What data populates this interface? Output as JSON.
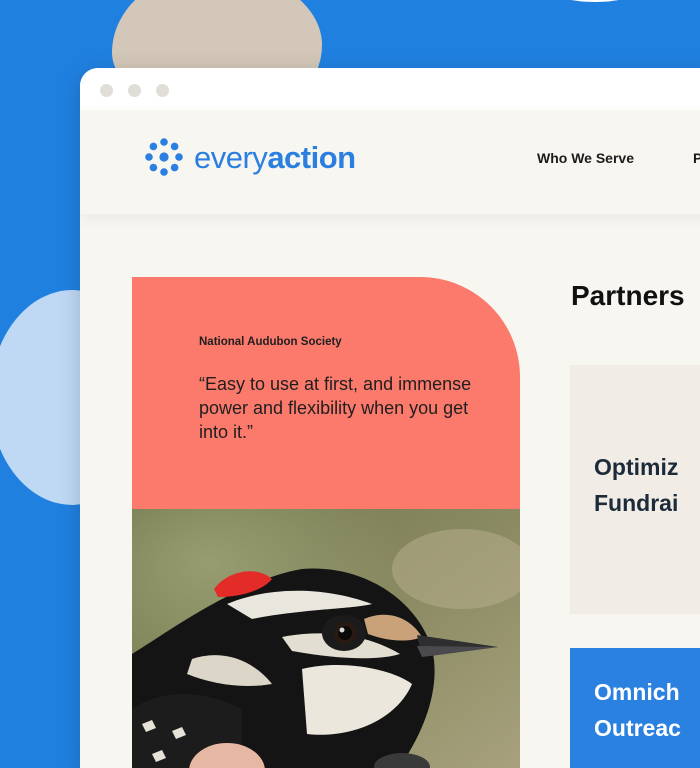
{
  "brand": {
    "logo_every": "every",
    "logo_action": "action",
    "color": "#2b7fe0"
  },
  "nav": {
    "items": [
      {
        "label": "Who We Serve"
      },
      {
        "label": "P"
      }
    ]
  },
  "testimonial": {
    "organization": "National Audubon Society",
    "quote": "“Easy to use at first, and immense power and flexibility when you get into it.”",
    "image": "woodpecker-photo",
    "accent_color": "#fb7a6b"
  },
  "section": {
    "heading": "Partners"
  },
  "panels": [
    {
      "title_line1": "Optimiz",
      "title_line2": "Fundrai"
    },
    {
      "title_line1": "Omnich",
      "title_line2": "Outreac"
    }
  ],
  "colors": {
    "background": "#2080e0",
    "page": "#f8f6f1",
    "panel_beige": "#f1ede6",
    "panel_blue": "#2b81e0"
  }
}
